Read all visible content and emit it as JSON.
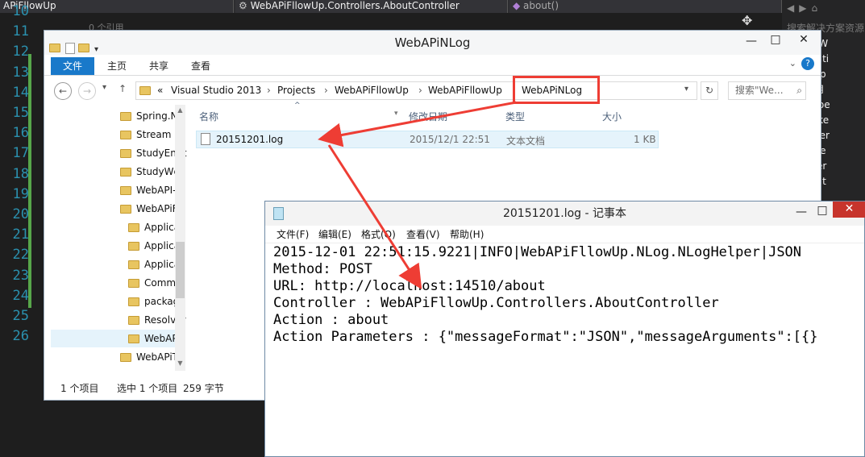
{
  "vs": {
    "top_project": "APiFllowUp",
    "top_class": "WebAPiFllowUp.Controllers.AboutController",
    "top_member": "about()",
    "ghost_code": "0 个引用",
    "line_numbers": [
      "10",
      "11",
      "12",
      "13",
      "14",
      "15",
      "16",
      "17",
      "18",
      "19",
      "20",
      "21",
      "22",
      "23",
      "24",
      "25",
      "26"
    ],
    "right_panel": [
      "搜索解决方案资源",
      "决方案'W",
      "Applicati",
      "Prop",
      "引用",
      "Depe",
      "IToke",
      "IUser",
      "Toke",
      "User",
      "Applicat"
    ]
  },
  "explorer": {
    "title": "WebAPiNLog",
    "tabs": [
      "文件",
      "主页",
      "共享",
      "查看"
    ],
    "breadcrumb": [
      "Visual Studio 2013",
      "Projects",
      "WebAPiFllowUp",
      "WebAPiFllowUp",
      "WebAPiNLog"
    ],
    "search_placeholder": "搜索\"We...",
    "nav_items": [
      {
        "label": "Spring.Ne"
      },
      {
        "label": "Stream"
      },
      {
        "label": "StudyEntit"
      },
      {
        "label": "StudyWcf!"
      },
      {
        "label": "WebAPI-C"
      },
      {
        "label": "WebAPiFll"
      },
      {
        "label": "Applicati"
      },
      {
        "label": "Applicat"
      },
      {
        "label": "Applicat"
      },
      {
        "label": "Commo"
      },
      {
        "label": "package"
      },
      {
        "label": "Resolver"
      },
      {
        "label": "WebAPil"
      },
      {
        "label": "WebAPiTe"
      },
      {
        "label": "xUnitTest"
      }
    ],
    "columns": [
      "名称",
      "修改日期",
      "类型",
      "大小"
    ],
    "files": [
      {
        "name": "20151201.log",
        "date": "2015/12/1 22:51",
        "type": "文本文档",
        "size": "1 KB"
      }
    ],
    "status_items": "1 个项目",
    "status_selected": "选中 1 个项目",
    "status_bytes": "259 字节"
  },
  "notepad": {
    "title": "20151201.log - 记事本",
    "menu": [
      "文件(F)",
      "编辑(E)",
      "格式(O)",
      "查看(V)",
      "帮助(H)"
    ],
    "lines": [
      "2015-12-01 22:51:15.9221|INFO|WebAPiFllowUp.NLog.NLogHelper|JSON",
      "Method: POST",
      "URL: http://localhost:14510/about",
      "Controller : WebAPiFllowUp.Controllers.AboutController",
      "Action : about",
      "Action Parameters : {\"messageFormat\":\"JSON\",\"messageArguments\":[{}"
    ]
  },
  "colors": {
    "annotation": "#ee3d34",
    "ribbon_file_tab": "#1979ca",
    "line_numbers": "#2b91af"
  }
}
